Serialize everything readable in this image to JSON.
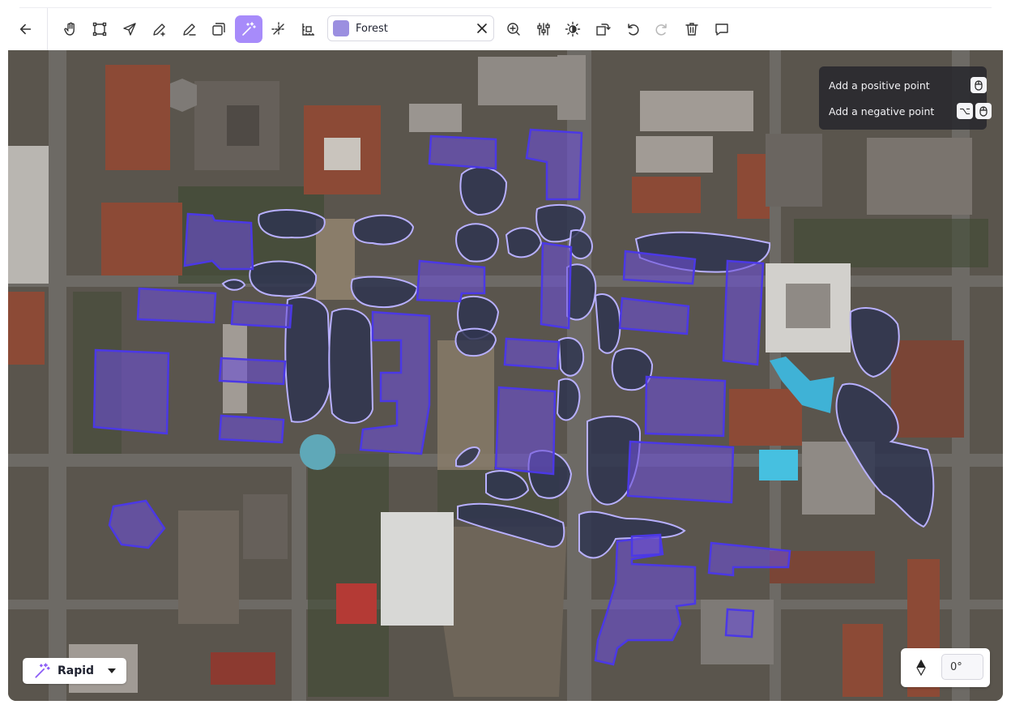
{
  "toolbar": {
    "tools": [
      {
        "name": "back-arrow-icon",
        "active": false
      },
      {
        "name": "hand-pan-icon",
        "active": false
      },
      {
        "name": "polygon-icon",
        "active": false
      },
      {
        "name": "cursor-arrow-icon",
        "active": false
      },
      {
        "name": "pen-add-icon",
        "active": false
      },
      {
        "name": "pen-edit-icon",
        "active": false
      },
      {
        "name": "copy-layers-icon",
        "active": false
      },
      {
        "name": "magic-wand-icon",
        "active": true
      },
      {
        "name": "split-cross-icon",
        "active": false
      },
      {
        "name": "ruler-measure-icon",
        "active": false
      },
      {
        "name": "zoom-in-icon",
        "active": false
      },
      {
        "name": "sliders-icon",
        "active": false
      },
      {
        "name": "brightness-icon",
        "active": false
      },
      {
        "name": "rotate-square-icon",
        "active": false
      },
      {
        "name": "undo-icon",
        "active": false
      },
      {
        "name": "redo-icon",
        "active": false,
        "disabled": true
      },
      {
        "name": "trash-icon",
        "active": false
      },
      {
        "name": "comment-icon",
        "active": false
      }
    ]
  },
  "class_select": {
    "label": "Forest",
    "color": "#9b8fe0"
  },
  "hints": {
    "positive": "Add a positive point",
    "negative": "Add a negative point",
    "negative_modifier": "⌥"
  },
  "mode": {
    "label": "Rapid"
  },
  "orientation": {
    "value": "0°"
  },
  "colors": {
    "accent": "#a78bfa",
    "building_fill": "#6a4fd6",
    "building_stroke": "#4b38e6",
    "tree_fill": "#2f3550",
    "tree_stroke": "#b8b0ff"
  }
}
